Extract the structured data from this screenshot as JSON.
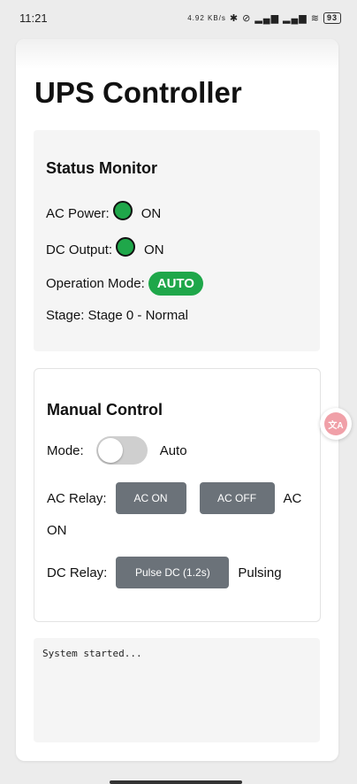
{
  "status_bar": {
    "time": "11:21",
    "net_speed": "4.92 KB/s",
    "icons": [
      "bluetooth-icon",
      "alarm-off-icon",
      "signal-5g-icon",
      "signal-5g-icon",
      "wifi-icon"
    ],
    "battery": "93"
  },
  "page": {
    "title": "UPS Controller"
  },
  "status_monitor": {
    "title": "Status Monitor",
    "ac_power_label": "AC Power:",
    "ac_power_value": "ON",
    "dc_output_label": "DC Output:",
    "dc_output_value": "ON",
    "operation_mode_label": "Operation Mode:",
    "operation_mode_value": "AUTO",
    "stage_text": "Stage: Stage 0 - Normal",
    "colors": {
      "led_on": "#1fa74a",
      "badge_auto": "#1fa74a"
    }
  },
  "manual_control": {
    "title": "Manual Control",
    "mode_label": "Mode:",
    "mode_value": "Auto",
    "toggle_on": false,
    "ac_relay_label": "AC Relay:",
    "ac_on_button": "AC ON",
    "ac_off_button": "AC OFF",
    "ac_status_1": "AC",
    "ac_status_2": "ON",
    "dc_relay_label": "DC Relay:",
    "pulse_button": "Pulse DC (1.2s)",
    "dc_status": "Pulsing",
    "colors": {
      "button_bg": "#6b7279"
    }
  },
  "console": {
    "log": "System started..."
  },
  "overlay": {
    "translate_icon": "translate-icon",
    "translate_glyph": "文A"
  }
}
